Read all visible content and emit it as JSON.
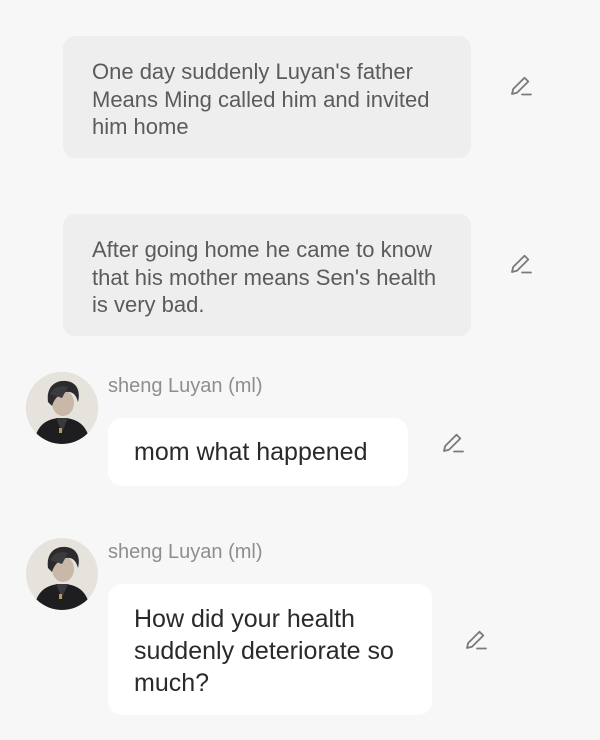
{
  "narrations": [
    {
      "text": "One day suddenly Luyan's father Means Ming called him and invited him home"
    },
    {
      "text": "After going home he came to know that his mother means Sen's health is very bad."
    }
  ],
  "messages": [
    {
      "speaker": "sheng Luyan (ml)",
      "text": "mom what happened"
    },
    {
      "speaker": "sheng Luyan (ml)",
      "text": "How did your health suddenly deteriorate so much?"
    }
  ],
  "icons": {
    "edit": "pencil-edit-icon",
    "avatar": "character-portrait"
  },
  "colors": {
    "background": "#f7f7f7",
    "narration_bg": "#eeeeee",
    "bubble_bg": "#ffffff",
    "speaker_text": "#8e8e8e",
    "icon": "#7a7a7a"
  }
}
